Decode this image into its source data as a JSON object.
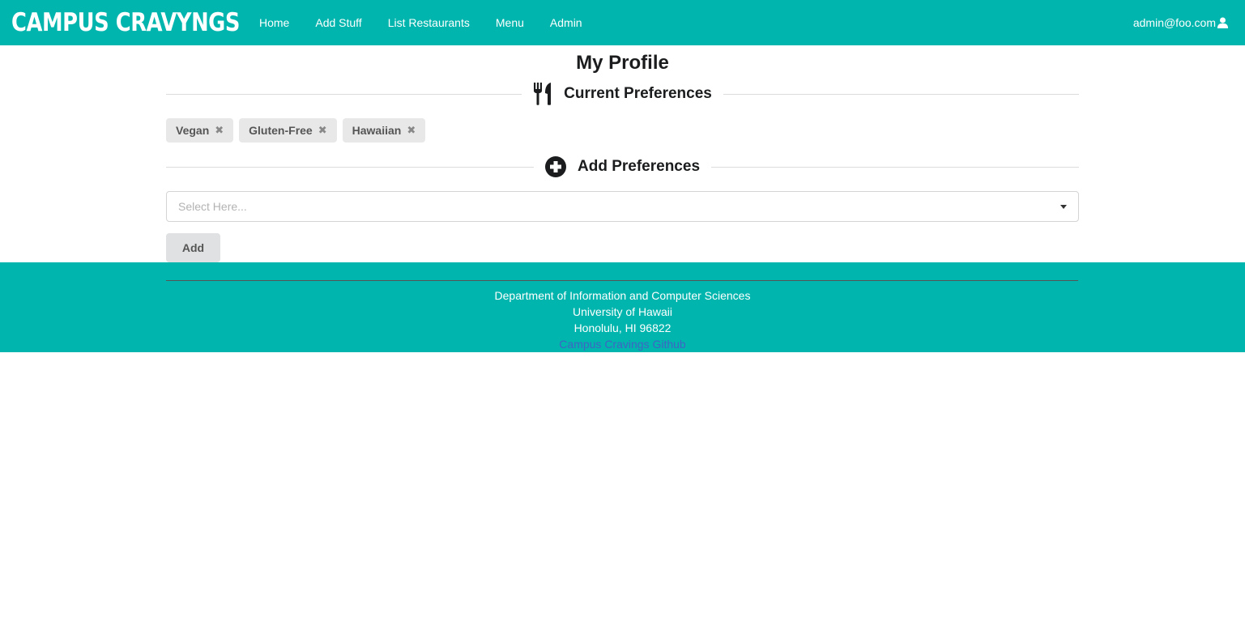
{
  "brand": {
    "logo_text": "CAMPUS CRAVYNGS",
    "accent_color": "#00b5ad"
  },
  "nav": {
    "items": [
      {
        "label": "Home"
      },
      {
        "label": "Add Stuff"
      },
      {
        "label": "List Restaurants"
      },
      {
        "label": "Menu"
      },
      {
        "label": "Admin"
      }
    ],
    "user_email": "admin@foo.com",
    "user_icon": "user-icon"
  },
  "main": {
    "title": "My Profile",
    "current_section": {
      "label": "Current Preferences",
      "icon": "utensils-icon"
    },
    "preferences": [
      {
        "label": "Vegan",
        "remove_icon": "close-icon"
      },
      {
        "label": "Gluten-Free",
        "remove_icon": "close-icon"
      },
      {
        "label": "Hawaiian",
        "remove_icon": "close-icon"
      }
    ],
    "add_section": {
      "label": "Add Preferences",
      "icon": "plus-circle-icon"
    },
    "select": {
      "placeholder": "Select Here..."
    },
    "add_button": "Add"
  },
  "footer": {
    "line1": "Department of Information and Computer Sciences",
    "line2": "University of Hawaii",
    "line3": "Honolulu, HI 96822",
    "link": "Campus Cravings Github"
  }
}
